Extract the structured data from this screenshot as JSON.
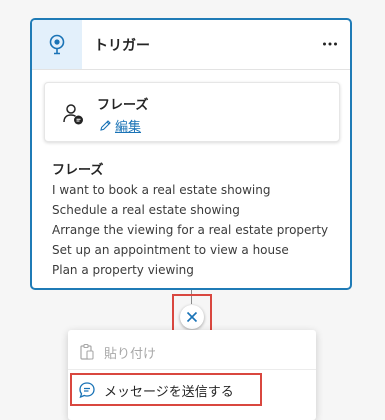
{
  "node": {
    "title": "トリガー",
    "icon": "trigger-pin-icon",
    "more_icon": "more-horizontal-icon"
  },
  "trigger_card": {
    "title": "フレーズ",
    "edit_label": "編集",
    "icon": "person-chat-icon"
  },
  "phrases": {
    "title": "フレーズ",
    "items": [
      "I want to book a real estate showing",
      "Schedule a real estate showing",
      "Arrange the viewing for a real estate property",
      "Set up an appointment to view a house",
      "Plan a property viewing"
    ]
  },
  "menu": {
    "paste_label": "貼り付け",
    "send_message_label": "メッセージを送信する"
  },
  "colors": {
    "accent": "#1f7bb6",
    "link": "#1a73b6",
    "highlight": "#d9473f",
    "icon_bg": "#e3f0fb"
  }
}
